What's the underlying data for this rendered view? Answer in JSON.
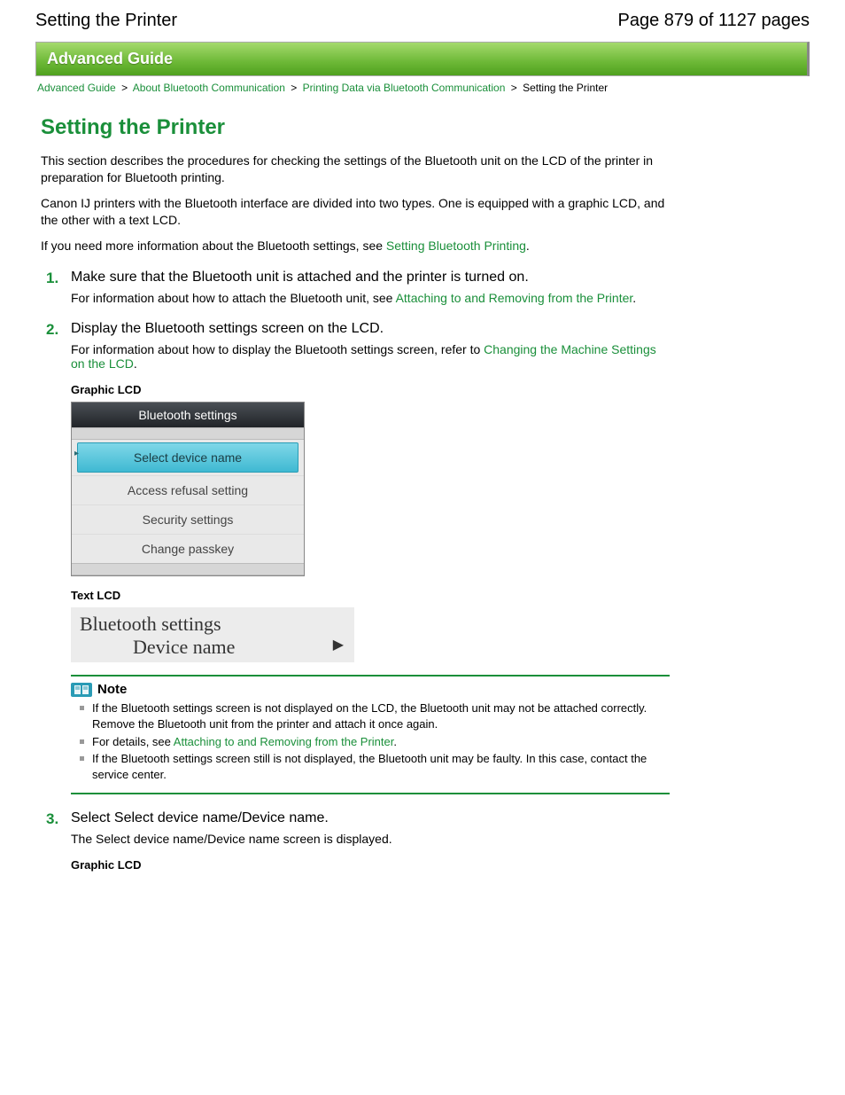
{
  "header": {
    "title": "Setting the Printer",
    "page_counter": "Page 879 of 1127 pages"
  },
  "banner": {
    "title": "Advanced Guide"
  },
  "breadcrumb": {
    "items": [
      "Advanced Guide",
      "About Bluetooth Communication",
      "Printing Data via Bluetooth Communication",
      "Setting the Printer"
    ]
  },
  "page": {
    "title": "Setting the Printer",
    "intro": [
      "This section describes the procedures for checking the settings of the Bluetooth unit on the LCD of the printer in preparation for Bluetooth printing.",
      "Canon IJ printers with the Bluetooth interface are divided into two types. One is equipped with a graphic LCD, and the other with a text LCD."
    ],
    "intro3_prefix": "If you need more information about the Bluetooth settings, see ",
    "intro3_link": "Setting Bluetooth Printing",
    "intro3_suffix": "."
  },
  "steps": [
    {
      "num": "1.",
      "title": "Make sure that the Bluetooth unit is attached and the printer is turned on.",
      "sub_prefix": "For information about how to attach the Bluetooth unit, see ",
      "sub_link": "Attaching to and Removing from the Printer",
      "sub_suffix": "."
    },
    {
      "num": "2.",
      "title": "Display the Bluetooth settings screen on the LCD.",
      "sub_prefix": "For information about how to display the Bluetooth settings screen, refer to ",
      "sub_link": "Changing the Machine Settings on the LCD",
      "sub_suffix": ".",
      "graphic_label": "Graphic LCD",
      "text_label": "Text LCD"
    },
    {
      "num": "3.",
      "title": "Select Select device name/Device name.",
      "sub": "The Select device name/Device name screen is displayed.",
      "graphic_label": "Graphic LCD"
    }
  ],
  "graphic_lcd": {
    "title": "Bluetooth settings",
    "items": [
      "Select device name",
      "Access refusal setting",
      "Security settings",
      "Change passkey"
    ]
  },
  "text_lcd": {
    "line1": "Bluetooth settings",
    "line2": "Device name"
  },
  "note": {
    "title": "Note",
    "items": [
      "If the Bluetooth settings screen is not displayed on the LCD, the Bluetooth unit may not be attached correctly. Remove the Bluetooth unit from the printer and attach it once again.",
      "",
      "If the Bluetooth settings screen still is not displayed, the Bluetooth unit may be faulty. In this case, contact the service center."
    ],
    "item2_prefix": "For details, see ",
    "item2_link": "Attaching to and Removing from the Printer",
    "item2_suffix": "."
  }
}
